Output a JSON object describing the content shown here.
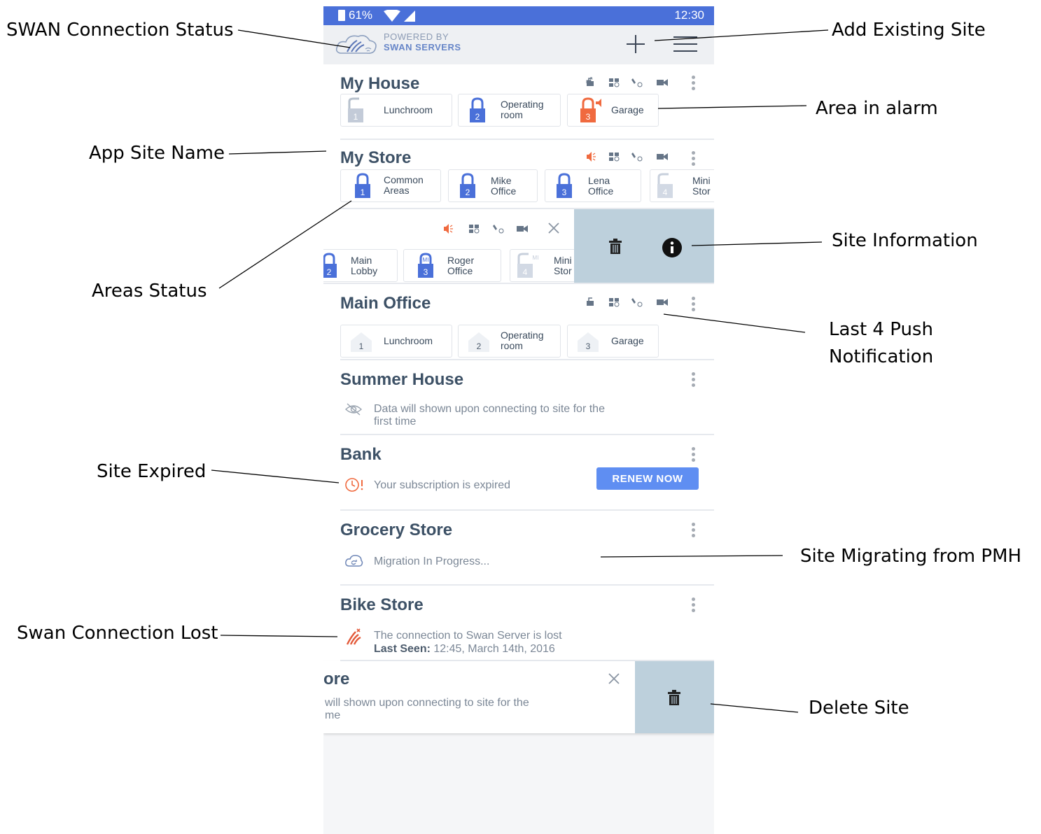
{
  "annotations": {
    "connection_status": "SWAN Connection Status",
    "add_site": "Add Existing Site",
    "area_alarm": "Area in alarm",
    "site_name": "App Site Name",
    "site_info": "Site Information",
    "areas_status": "Areas Status",
    "last_push_1": "Last 4 Push",
    "last_push_2": "Notification",
    "site_expired": "Site Expired",
    "migrating": "Site Migrating from PMH",
    "connection_lost": "Swan Connection Lost",
    "delete_site": "Delete Site"
  },
  "status_bar": {
    "battery": "61%",
    "time": "12:30"
  },
  "header": {
    "powered_by": "POWERED BY",
    "brand": "SWAN SERVERS"
  },
  "sites": {
    "my_house": {
      "name": "My House",
      "areas": [
        {
          "num": "1",
          "l1": "Lunchroom",
          "l2": ""
        },
        {
          "num": "2",
          "l1": "Operating",
          "l2": "room"
        },
        {
          "num": "3",
          "l1": "Garage",
          "l2": ""
        }
      ]
    },
    "my_store": {
      "name": "My Store",
      "areas": [
        {
          "num": "1",
          "l1": "Common",
          "l2": "Areas"
        },
        {
          "num": "2",
          "l1": "Mike",
          "l2": "Office"
        },
        {
          "num": "3",
          "l1": "Lena",
          "l2": "Office"
        },
        {
          "num": "4",
          "l1": "Mini",
          "l2": "Stor"
        }
      ]
    },
    "swiped": {
      "areas": [
        {
          "num": "2",
          "l1": "Main",
          "l2": "Lobby"
        },
        {
          "num": "3",
          "l1": "Roger",
          "l2": "Office",
          "badge": "MI"
        },
        {
          "num": "4",
          "l1": "Mini",
          "l2": "Stor",
          "badge": "MI"
        }
      ]
    },
    "main_office": {
      "name": "Main Office",
      "areas": [
        {
          "num": "1",
          "l1": "Lunchroom",
          "l2": ""
        },
        {
          "num": "2",
          "l1": "Operating",
          "l2": "room"
        },
        {
          "num": "3",
          "l1": "Garage",
          "l2": ""
        }
      ]
    },
    "summer_house": {
      "name": "Summer House",
      "line1": "Data will shown upon connecting to site for the",
      "line2": "first time"
    },
    "bank": {
      "name": "Bank",
      "message": "Your subscription is expired",
      "button": "RENEW NOW"
    },
    "grocery": {
      "name": "Grocery Store",
      "message": "Migration In Progress..."
    },
    "bike": {
      "name": "Bike Store",
      "line1": "The connection to Swan Server is lost",
      "seen_label": "Last Seen:",
      "seen_value": "12:45, March 14th, 2016"
    },
    "deleted": {
      "name": "ore",
      "line1": "will shown upon connecting to site for the",
      "line2": "me"
    }
  },
  "colors": {
    "primary": "#4a70d9",
    "alarm": "#f06a3f",
    "disabled": "#c3cbd8",
    "swipe": "#bdd0dc",
    "button": "#5f8ef2"
  },
  "icons": [
    "lock-icon",
    "alarm-speaker-icon",
    "arm-mode-icon",
    "plug-icon",
    "camera-icon",
    "trash-icon",
    "info-icon",
    "close-icon",
    "eye-off-icon",
    "clock-icon",
    "cloud-sync-icon",
    "swan-logo-icon",
    "add-icon",
    "menu-icon"
  ]
}
